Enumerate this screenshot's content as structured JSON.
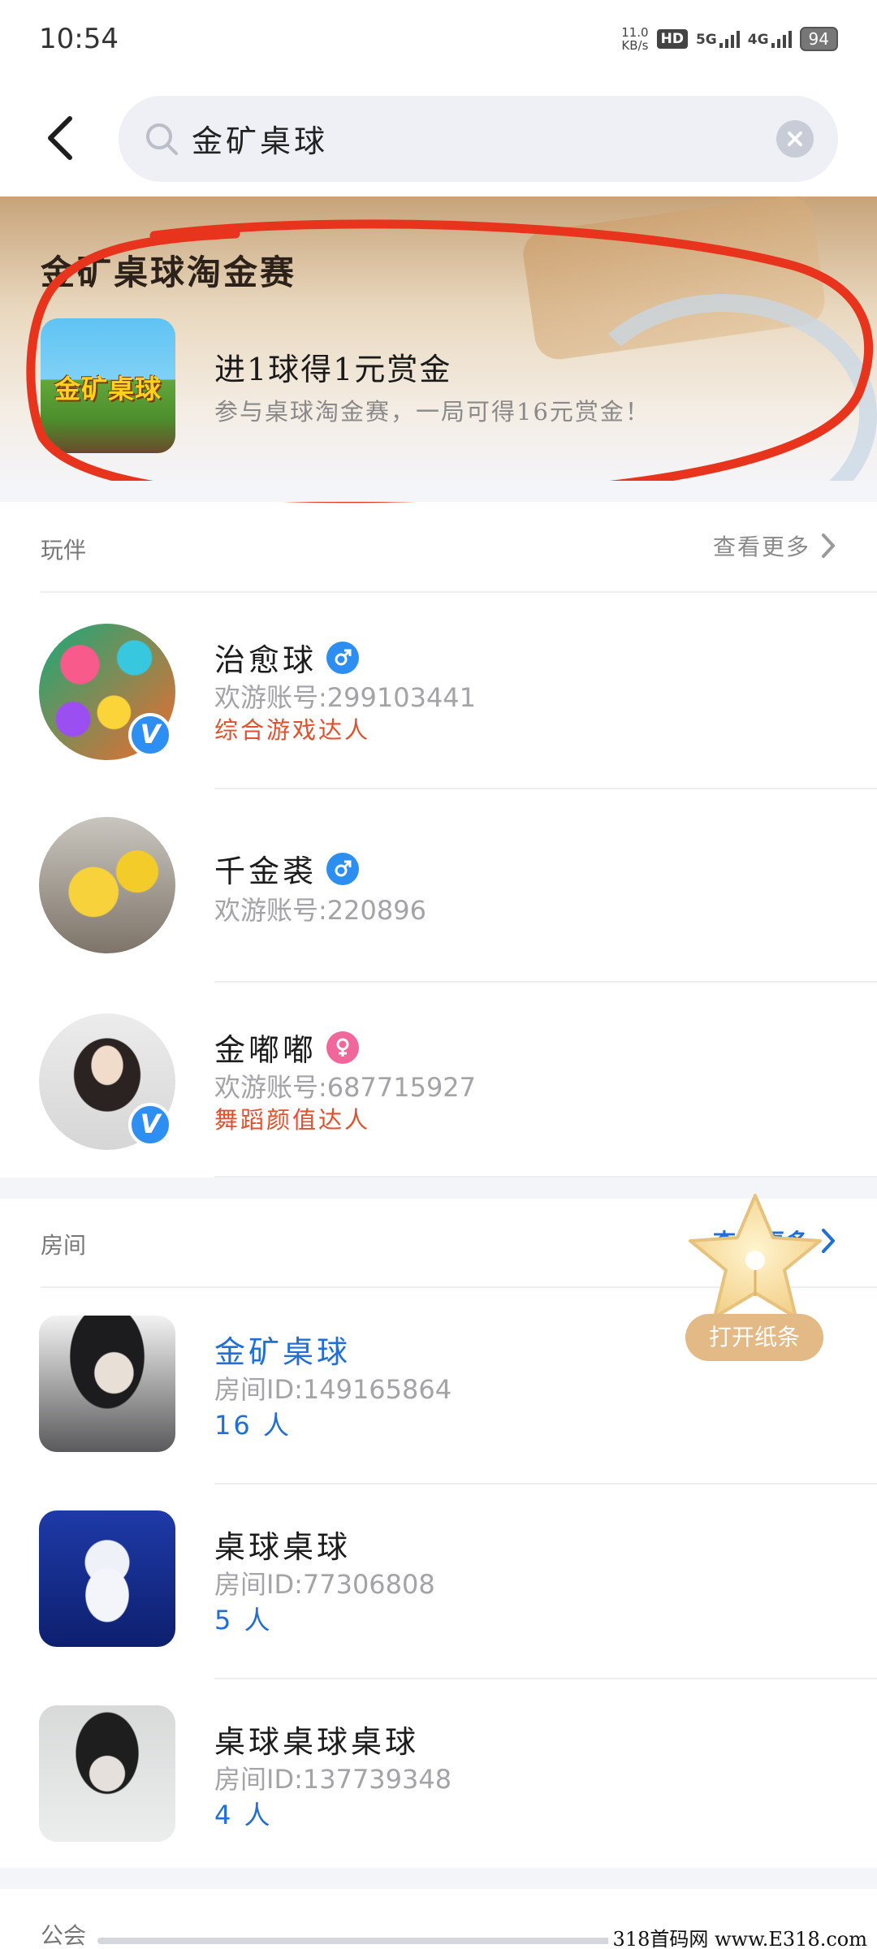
{
  "status_bar": {
    "time": "10:54",
    "net_speed_value": "11.0",
    "net_speed_unit": "KB/s",
    "hd_label": "HD",
    "sim1": "5G",
    "sim2": "4G",
    "battery": "94"
  },
  "search": {
    "query": "金矿桌球"
  },
  "banner": {
    "title": "金矿桌球淘金赛",
    "game_logo_text": "金矿桌球",
    "headline": "进1球得1元赏金",
    "subtitle": "参与桌球淘金赛，一局可得16元赏金！"
  },
  "companions": {
    "title": "玩伴",
    "more_label": "查看更多",
    "items": [
      {
        "name": "治愈球",
        "gender": "male",
        "account": "欢游账号:299103441",
        "tag": "综合游戏达人",
        "verified": true
      },
      {
        "name": "千金裘",
        "gender": "male",
        "account": "欢游账号:220896",
        "tag": "",
        "verified": false
      },
      {
        "name": "金嘟嘟",
        "gender": "female",
        "account": "欢游账号:687715927",
        "tag": "舞蹈颜值达人",
        "verified": true
      }
    ]
  },
  "rooms": {
    "title": "房间",
    "more_label": "查看更多",
    "items": [
      {
        "name": "金矿桌球",
        "room_id": "房间ID:149165864",
        "count": "16 人"
      },
      {
        "name": "桌球桌球",
        "room_id": "房间ID:77306808",
        "count": "5 人"
      },
      {
        "name": "桌球桌球桌球",
        "room_id": "房间ID:137739348",
        "count": "4 人"
      }
    ]
  },
  "floating": {
    "label": "打开纸条"
  },
  "guild": {
    "title": "公会"
  },
  "watermark": "318首码网 www.E318.com",
  "colors": {
    "accent_blue": "#1f6fd6",
    "tag_red": "#e3502c",
    "annotation_red": "#e8341c"
  }
}
